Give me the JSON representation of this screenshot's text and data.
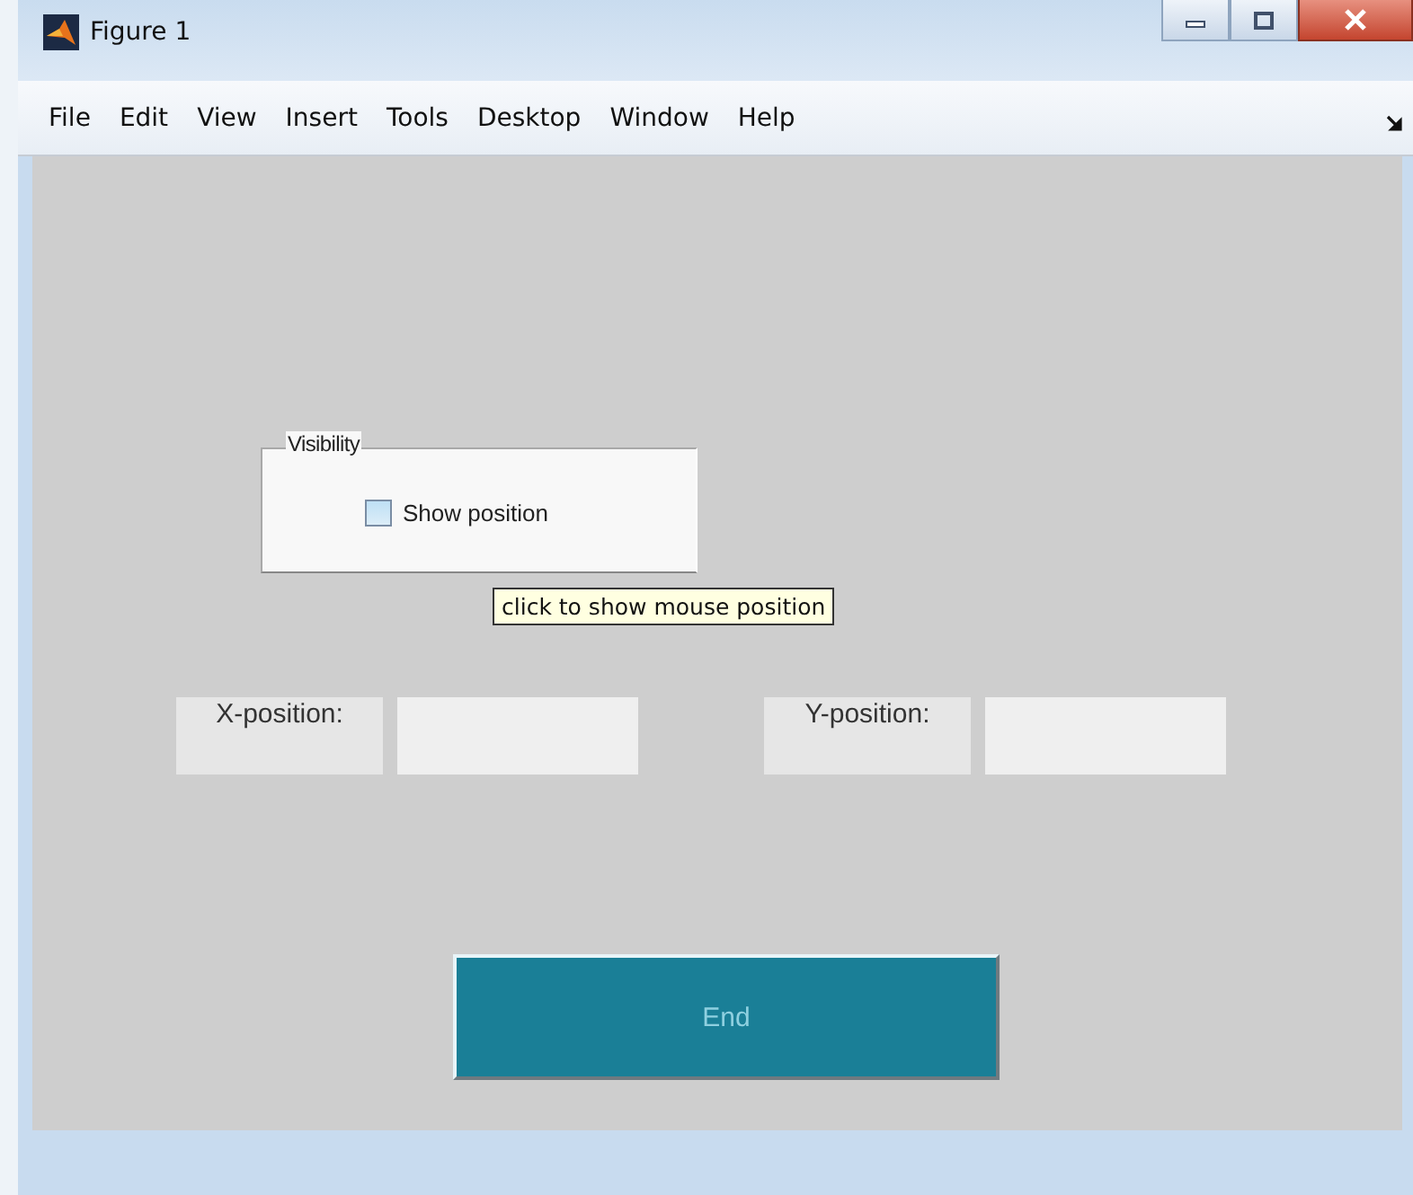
{
  "window": {
    "title": "Figure 1"
  },
  "menu": [
    "File",
    "Edit",
    "View",
    "Insert",
    "Tools",
    "Desktop",
    "Window",
    "Help"
  ],
  "panel": {
    "title": "Visibility",
    "checkbox": {
      "label": "Show position",
      "checked": false
    }
  },
  "tooltip": "click to show mouse position",
  "fields": [
    {
      "label": "X-position:"
    },
    {
      "label": "Y-position:"
    }
  ],
  "button": {
    "label": "End"
  }
}
